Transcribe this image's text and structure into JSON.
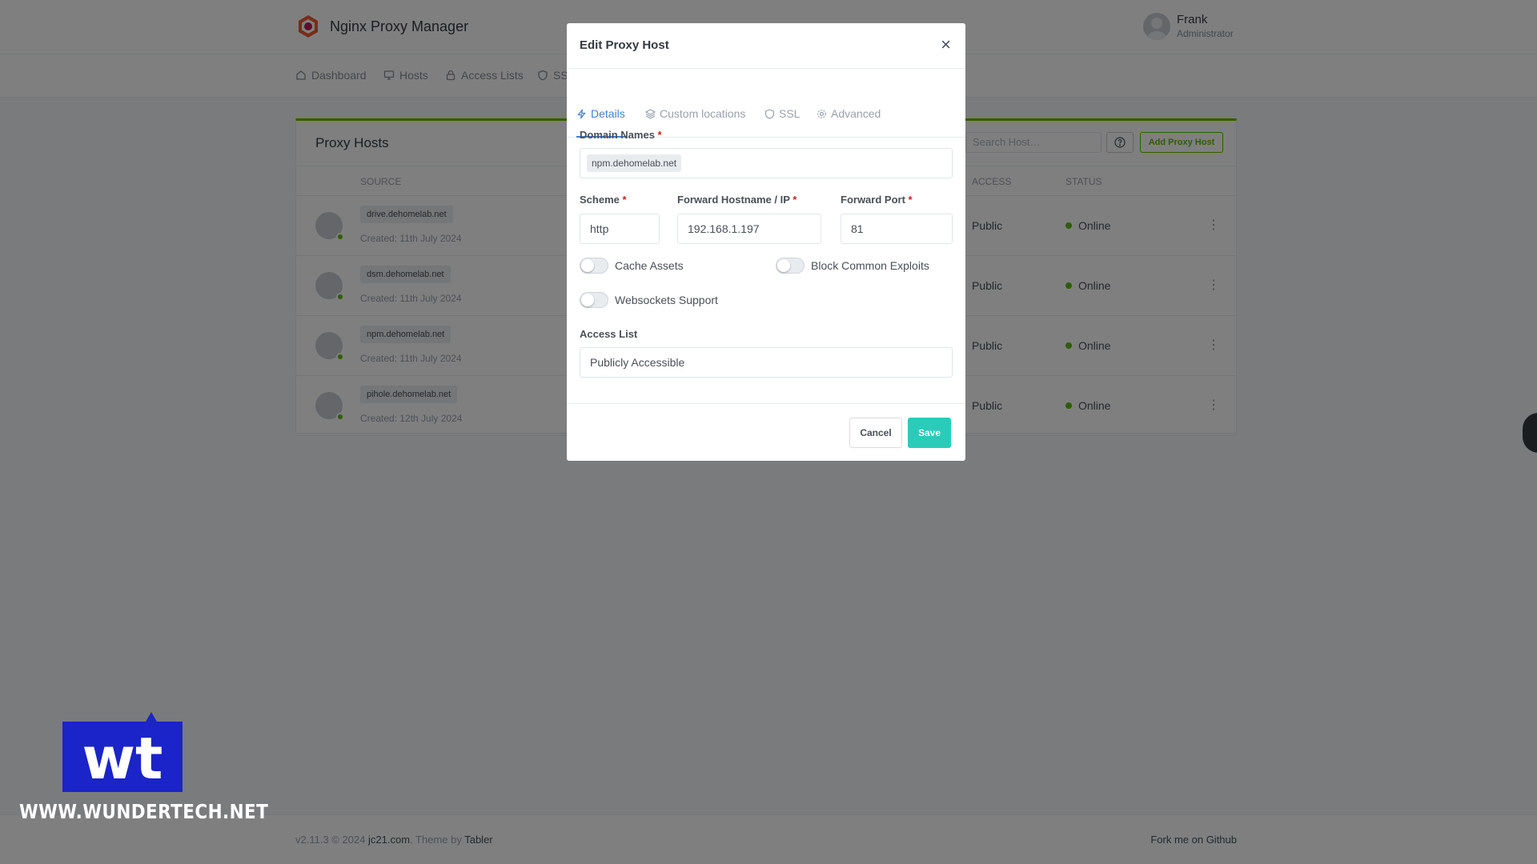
{
  "app": {
    "name": "Nginx Proxy Manager",
    "user": {
      "name": "Frank",
      "role": "Administrator"
    }
  },
  "nav": {
    "items": [
      {
        "label": "Dashboard",
        "icon": "home-icon"
      },
      {
        "label": "Hosts",
        "icon": "monitor-icon"
      },
      {
        "label": "Access Lists",
        "icon": "lock-icon"
      },
      {
        "label": "SSL",
        "icon": "shield-icon"
      }
    ]
  },
  "proxy_hosts": {
    "title": "Proxy Hosts",
    "search_placeholder": "Search Host…",
    "add_label": "Add Proxy Host",
    "columns": {
      "source": "SOURCE",
      "access": "ACCESS",
      "status": "STATUS"
    },
    "rows": [
      {
        "domain": "drive.dehomelab.net",
        "created": "Created: 11th July 2024",
        "access": "Public",
        "status": "Online"
      },
      {
        "domain": "dsm.dehomelab.net",
        "created": "Created: 11th July 2024",
        "access": "Public",
        "status": "Online"
      },
      {
        "domain": "npm.dehomelab.net",
        "created": "Created: 11th July 2024",
        "access": "Public",
        "status": "Online"
      },
      {
        "domain": "pihole.dehomelab.net",
        "created": "Created: 12th July 2024",
        "access": "Public",
        "status": "Online"
      }
    ]
  },
  "footer": {
    "version": "v2.11.3 © 2024 ",
    "company": "jc21.com",
    "theme_by": ". Theme by ",
    "theme": "Tabler",
    "fork": "Fork me on Github"
  },
  "watermark": {
    "text": "WWW.WUNDERTECH.NET",
    "logo_text": "wt"
  },
  "modal": {
    "title": "Edit Proxy Host",
    "close": "×",
    "tabs": [
      {
        "label": "Details",
        "icon": "bolt-icon",
        "active": true
      },
      {
        "label": "Custom locations",
        "icon": "layers-icon",
        "active": false
      },
      {
        "label": "SSL",
        "icon": "shield-icon",
        "active": false
      },
      {
        "label": "Advanced",
        "icon": "gear-icon",
        "active": false
      }
    ],
    "domain_names": {
      "label": "Domain Names",
      "required": "*",
      "chips": [
        "npm.dehomelab.net"
      ]
    },
    "scheme": {
      "label": "Scheme",
      "required": "*",
      "value": "http"
    },
    "forward_host": {
      "label": "Forward Hostname / IP",
      "required": "*",
      "value": "192.168.1.197"
    },
    "forward_port": {
      "label": "Forward Port",
      "required": "*",
      "value": "81"
    },
    "toggles": {
      "cache_assets": {
        "label": "Cache Assets",
        "on": false
      },
      "block_exploits": {
        "label": "Block Common Exploits",
        "on": false
      },
      "websockets": {
        "label": "Websockets Support",
        "on": false
      }
    },
    "access_list": {
      "label": "Access List",
      "value": "Publicly Accessible"
    },
    "cancel_label": "Cancel",
    "save_label": "Save"
  },
  "colors": {
    "accent_green": "#5eba00",
    "save_teal": "#2bcbba",
    "tab_active_blue": "#467fcf",
    "required_red": "#cd201f",
    "watermark_blue": "#1a24c9"
  }
}
